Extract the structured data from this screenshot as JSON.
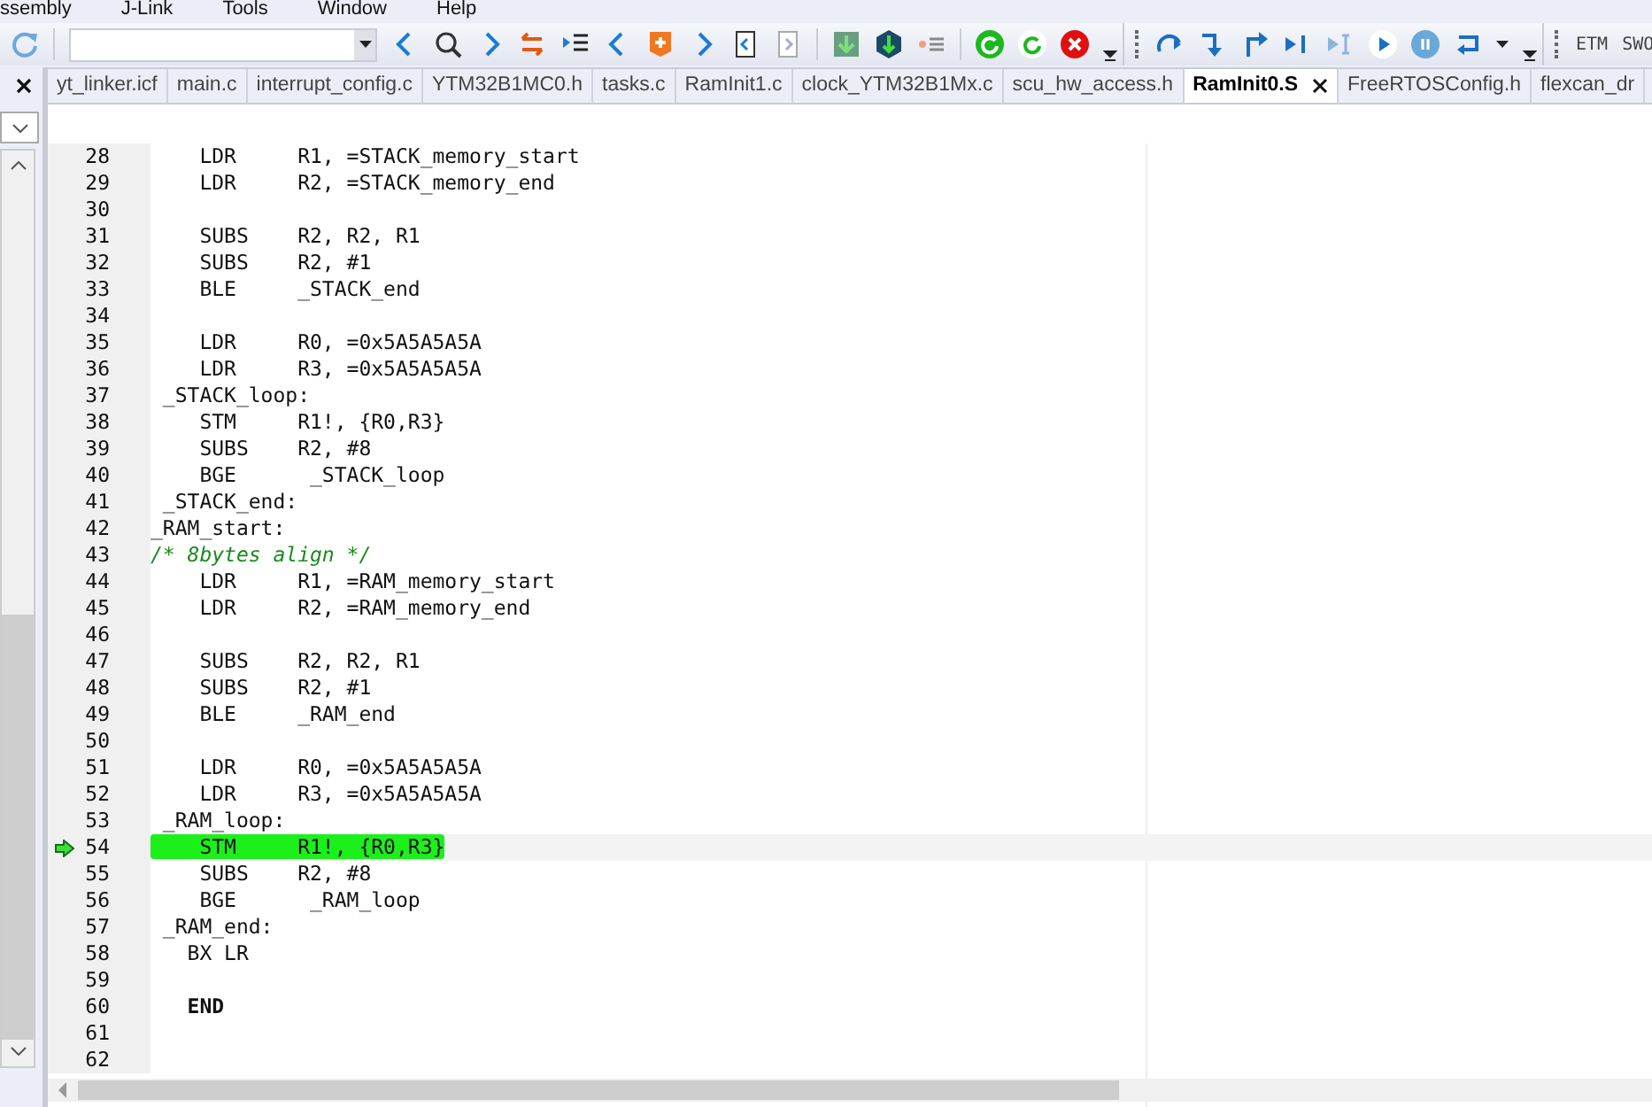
{
  "menu_bar": [
    "ssembly",
    "J-Link",
    "Tools",
    "Window",
    "Help"
  ],
  "toolbar": {
    "trace_buttons": [
      "ETM",
      "SWO"
    ]
  },
  "tabs": [
    {
      "label": "yt_linker.icf",
      "selected": false
    },
    {
      "label": "main.c",
      "selected": false
    },
    {
      "label": "interrupt_config.c",
      "selected": false
    },
    {
      "label": "YTM32B1MC0.h",
      "selected": false
    },
    {
      "label": "tasks.c",
      "selected": false
    },
    {
      "label": "RamInit1.c",
      "selected": false
    },
    {
      "label": "clock_YTM32B1Mx.c",
      "selected": false
    },
    {
      "label": "scu_hw_access.h",
      "selected": false
    },
    {
      "label": "RamInit0.S",
      "selected": true
    },
    {
      "label": "FreeRTOSConfig.h",
      "selected": false
    },
    {
      "label": "flexcan_dr",
      "selected": false
    }
  ],
  "editor": {
    "lines": [
      {
        "number": "28",
        "kind": "code",
        "text": "    LDR     R1, =STACK_memory_start",
        "current": false
      },
      {
        "number": "29",
        "kind": "code",
        "text": "    LDR     R2, =STACK_memory_end",
        "current": false
      },
      {
        "number": "30",
        "kind": "blank",
        "current": false
      },
      {
        "number": "31",
        "kind": "code",
        "text": "    SUBS    R2, R2, R1",
        "current": false
      },
      {
        "number": "32",
        "kind": "code",
        "text": "    SUBS    R2, #1",
        "current": false
      },
      {
        "number": "33",
        "kind": "code",
        "text": "    BLE     _STACK_end",
        "current": false
      },
      {
        "number": "34",
        "kind": "blank",
        "current": false
      },
      {
        "number": "35",
        "kind": "code",
        "text": "    LDR     R0, =0x5A5A5A5A",
        "current": false
      },
      {
        "number": "36",
        "kind": "code",
        "text": "    LDR     R3, =0x5A5A5A5A",
        "current": false
      },
      {
        "number": "37",
        "kind": "code",
        "text": " _STACK_loop:",
        "current": false
      },
      {
        "number": "38",
        "kind": "code",
        "text": "    STM     R1!, {R0,R3}",
        "current": false
      },
      {
        "number": "39",
        "kind": "code",
        "text": "    SUBS    R2, #8",
        "current": false
      },
      {
        "number": "40",
        "kind": "code",
        "text": "    BGE      _STACK_loop",
        "current": false
      },
      {
        "number": "41",
        "kind": "code",
        "text": " _STACK_end:",
        "current": false
      },
      {
        "number": "42",
        "kind": "code",
        "text": "_RAM_start:",
        "current": false
      },
      {
        "number": "43",
        "kind": "comment",
        "text": "/* 8bytes align */",
        "current": false
      },
      {
        "number": "44",
        "kind": "code",
        "text": "    LDR     R1, =RAM_memory_start",
        "current": false
      },
      {
        "number": "45",
        "kind": "code",
        "text": "    LDR     R2, =RAM_memory_end",
        "current": false
      },
      {
        "number": "46",
        "kind": "blank",
        "current": false
      },
      {
        "number": "47",
        "kind": "code",
        "text": "    SUBS    R2, R2, R1",
        "current": false
      },
      {
        "number": "48",
        "kind": "code",
        "text": "    SUBS    R2, #1",
        "current": false
      },
      {
        "number": "49",
        "kind": "code",
        "text": "    BLE     _RAM_end",
        "current": false
      },
      {
        "number": "50",
        "kind": "blank",
        "current": false
      },
      {
        "number": "51",
        "kind": "code",
        "text": "    LDR     R0, =0x5A5A5A5A",
        "current": false
      },
      {
        "number": "52",
        "kind": "code",
        "text": "    LDR     R3, =0x5A5A5A5A",
        "current": false
      },
      {
        "number": "53",
        "kind": "code",
        "text": " _RAM_loop:",
        "current": false
      },
      {
        "number": "54",
        "kind": "code",
        "text": "    STM     R1!, {R0,R3}",
        "current": true
      },
      {
        "number": "55",
        "kind": "code",
        "text": "    SUBS    R2, #8",
        "current": false
      },
      {
        "number": "56",
        "kind": "code",
        "text": "    BGE      _RAM_loop",
        "current": false
      },
      {
        "number": "57",
        "kind": "code",
        "text": " _RAM_end:",
        "current": false
      },
      {
        "number": "58",
        "kind": "code",
        "text": "   BX LR",
        "current": false
      },
      {
        "number": "59",
        "kind": "blank",
        "current": false
      },
      {
        "number": "60",
        "kind": "directive",
        "text": "   END",
        "current": false
      },
      {
        "number": "61",
        "kind": "blank",
        "current": false
      },
      {
        "number": "62",
        "kind": "blank",
        "current": false
      }
    ]
  }
}
